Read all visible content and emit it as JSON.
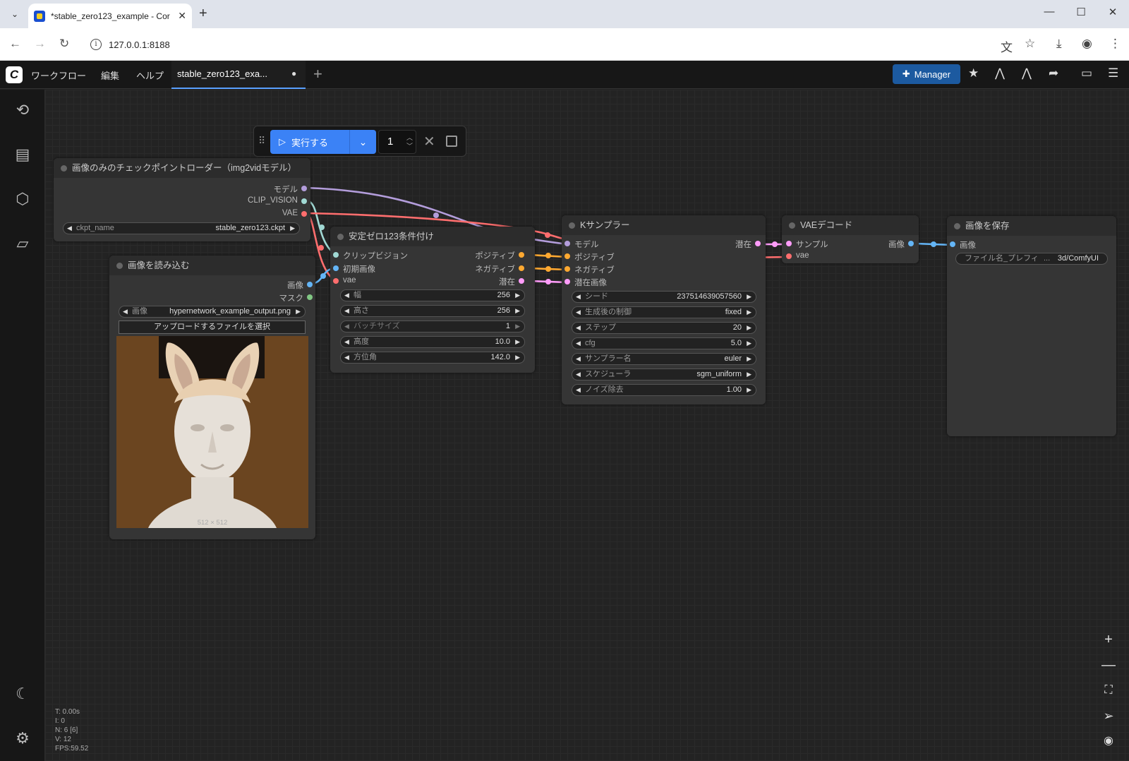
{
  "browser": {
    "tab_title": "*stable_zero123_example - Cor",
    "url": "127.0.0.1:8188"
  },
  "menu": {
    "items": [
      "ワークフロー",
      "編集",
      "ヘルプ"
    ],
    "workflow_tab": "stable_zero123_exa...",
    "modified_dot": "●",
    "manager_label": "Manager"
  },
  "toolbar": {
    "run_label": "実行する",
    "batch_count": "1"
  },
  "nodes": {
    "ckpt_loader": {
      "title": "画像のみのチェックポイントローダー（img2vidモデル）",
      "outputs": [
        "モデル",
        "CLIP_VISION",
        "VAE"
      ],
      "ckpt_label": "ckpt_name",
      "ckpt_value": "stable_zero123.ckpt"
    },
    "load_image": {
      "title": "画像を読み込む",
      "outputs": [
        "画像",
        "マスク"
      ],
      "image_label": "画像",
      "image_value": "hypernetwork_example_output.png",
      "upload_label": "アップロードするファイルを選択",
      "size_caption": "512 × 512"
    },
    "zero123_cond": {
      "title": "安定ゼロ123条件付け",
      "inputs": [
        "クリップビジョン",
        "初期画像",
        "vae"
      ],
      "outputs": [
        "ポジティブ",
        "ネガティブ",
        "潜在"
      ],
      "widgets": [
        {
          "label": "幅",
          "value": "256"
        },
        {
          "label": "高さ",
          "value": "256"
        },
        {
          "label": "バッチサイズ",
          "value": "1"
        },
        {
          "label": "高度",
          "value": "10.0"
        },
        {
          "label": "方位角",
          "value": "142.0"
        }
      ]
    },
    "ksampler": {
      "title": "Kサンプラー",
      "inputs": [
        "モデル",
        "ポジティブ",
        "ネガティブ",
        "潜在画像"
      ],
      "outputs": [
        "潜在"
      ],
      "widgets": [
        {
          "label": "シード",
          "value": "237514639057560"
        },
        {
          "label": "生成後の制御",
          "value": "fixed"
        },
        {
          "label": "ステップ",
          "value": "20"
        },
        {
          "label": "cfg",
          "value": "5.0"
        },
        {
          "label": "サンプラー名",
          "value": "euler"
        },
        {
          "label": "スケジューラ",
          "value": "sgm_uniform"
        },
        {
          "label": "ノイズ除去",
          "value": "1.00"
        }
      ]
    },
    "vae_decode": {
      "title": "VAEデコード",
      "inputs": [
        "サンプル",
        "vae"
      ],
      "outputs": [
        "画像"
      ]
    },
    "save_image": {
      "title": "画像を保存",
      "inputs": [
        "画像"
      ],
      "prefix_label": "ファイル名_プレフィ",
      "prefix_ellipsis": "...",
      "prefix_value": "3d/ComfyUI"
    }
  },
  "stats": {
    "t": "T: 0.00s",
    "i": "I: 0",
    "n": "N: 6 [6]",
    "v": "V: 12",
    "fps": "FPS:59.52"
  },
  "colors": {
    "accent": "#3b82f6",
    "manager": "#1c5aa0",
    "model_wire": "#b39ddb",
    "clip_vision_wire": "#a1d9d4",
    "vae_wire": "#ff6e6e",
    "image_wire": "#64b5f6",
    "conditioning_wire": "#ffa931",
    "latent_wire": "#ff9cf9",
    "mask_wire": "#81c784"
  }
}
